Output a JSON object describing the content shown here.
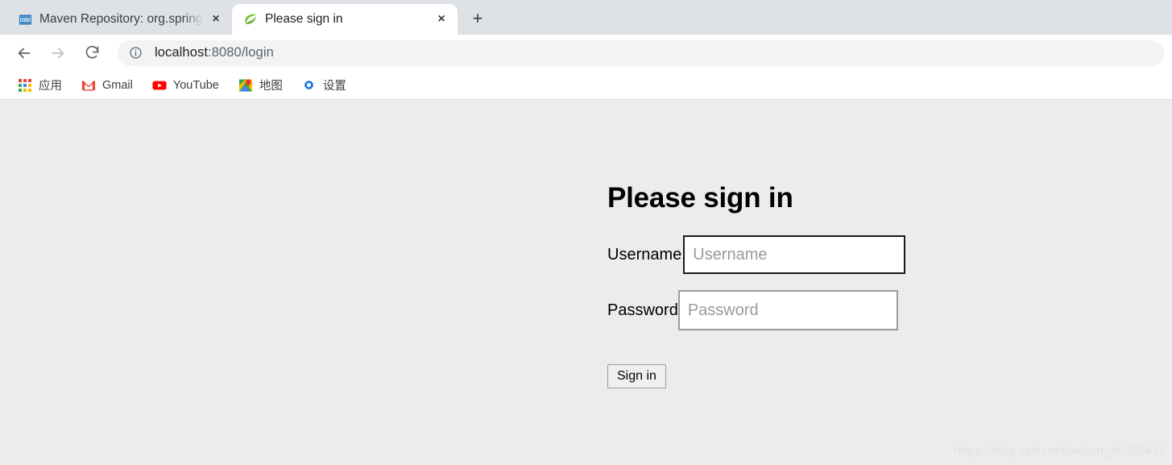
{
  "browser": {
    "tabs": [
      {
        "title": "Maven Repository: org.springf",
        "favicon": "maven-icon",
        "active": false,
        "close_label": "×"
      },
      {
        "title": "Please sign in",
        "favicon": "spring-leaf-icon",
        "active": true,
        "close_label": "×"
      }
    ],
    "new_tab_label": "+",
    "nav": {
      "back": "back-arrow-icon",
      "forward": "forward-arrow-icon",
      "reload": "reload-icon"
    },
    "omnibox": {
      "info_icon": "site-info-icon",
      "url_host": "localhost",
      "url_path": ":8080/login",
      "url_full": "localhost:8080/login"
    },
    "bookmarks": [
      {
        "label": "应用",
        "icon": "apps-grid-icon"
      },
      {
        "label": "Gmail",
        "icon": "gmail-icon"
      },
      {
        "label": "YouTube",
        "icon": "youtube-icon"
      },
      {
        "label": "地图",
        "icon": "google-maps-icon"
      },
      {
        "label": "设置",
        "icon": "settings-gear-icon"
      }
    ]
  },
  "page": {
    "title": "Please sign in",
    "username": {
      "label": "Username",
      "placeholder": "Username",
      "value": ""
    },
    "password": {
      "label": "Password",
      "placeholder": "Password",
      "value": ""
    },
    "submit_label": "Sign in",
    "watermark": "https://blog.csdn.net/weixin_45450412"
  },
  "colors": {
    "page_background": "#ececec",
    "tabstrip_background": "#dee1e6",
    "omnibox_background": "#f1f3f4",
    "focused_border": "#1a1a1a",
    "unfocused_border": "#9b9b9b",
    "gmail_red": "#ea4335",
    "youtube_red": "#ff0000",
    "gear_blue": "#1a73e8"
  }
}
